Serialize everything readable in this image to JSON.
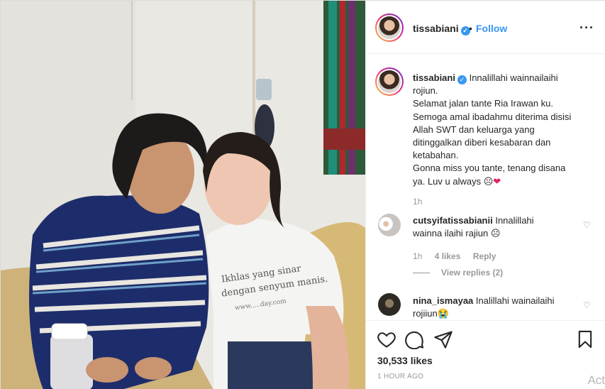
{
  "header": {
    "username": "tissabiani",
    "separator": "•",
    "follow_label": "Follow",
    "more_icon": "more-horizontal-icon"
  },
  "caption": {
    "username": "tissabiani",
    "lines": [
      "Innalillahi wainnailaihi",
      "rojiun.",
      "Selamat jalan tante Ria Irawan ku.",
      "Semoga amal ibadahmu diterima disisi",
      "Allah SWT dan keluarga yang",
      "ditinggalkan diberi kesabaran dan",
      "ketabahan.",
      "Gonna miss you tante, tenang disana",
      "ya. Luv u always"
    ],
    "emoji": [
      "☹",
      "❤"
    ],
    "time": "1h"
  },
  "comments": [
    {
      "username": "cutsyifatissabianii",
      "text_line1": "Innalillahi",
      "text_line2": "wainna ilaihi rajiun",
      "emoji": "☹",
      "time": "1h",
      "likes": "4 likes",
      "reply_label": "Reply",
      "view_replies": "View replies (2)"
    },
    {
      "username": "nina_ismayaa",
      "text_line1": "Inalillahi wainailaihi",
      "text_line2": "rojiiun",
      "emoji": "😭"
    }
  ],
  "actions": {
    "likes": "30,533 likes",
    "time": "1 HOUR AGO"
  },
  "photo": {
    "shirt_text_line1": "Ikhlas yang sinar",
    "shirt_text_line2": "dengan senyum manis.",
    "shirt_text_line3": "www.....day.com"
  },
  "watermark": "Act",
  "colors": {
    "link_blue": "#3897f0",
    "heart_red": "#e0245e",
    "meta_gray": "#999999"
  }
}
